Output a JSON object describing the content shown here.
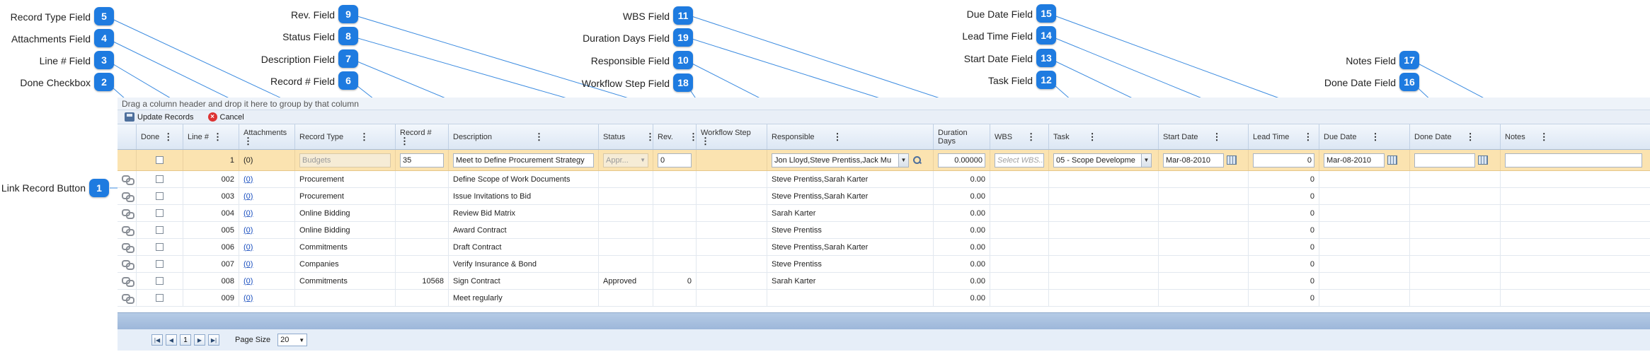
{
  "grid": {
    "group_hint": "Drag a column header and drop it here to group by that column",
    "toolbar": {
      "update_label": "Update Records",
      "cancel_label": "Cancel"
    },
    "columns": [
      "Done",
      "Line #",
      "Attachments",
      "Record Type",
      "Record #",
      "Description",
      "Status",
      "Rev.",
      "Workflow Step",
      "Responsible",
      "Duration Days",
      "WBS",
      "Task",
      "Start Date",
      "Lead Time",
      "Due Date",
      "Done Date",
      "Notes"
    ],
    "edit_row": {
      "line": "1",
      "attachments": "(0)",
      "record_type": "Budgets",
      "record_no": "35",
      "description": "Meet to Define Procurement Strategy",
      "status": "Appr...",
      "rev": "0",
      "responsible": "Jon Lloyd,Steve Prentiss,Jack Mu",
      "duration": "0.00000",
      "wbs_placeholder": "Select WBS...",
      "task": "05 - Scope Developme",
      "start_date": "Mar-08-2010",
      "lead_time": "0",
      "due_date": "Mar-08-2010"
    },
    "rows": [
      {
        "line": "002",
        "att": "(0)",
        "type": "Procurement",
        "rec": "",
        "desc": "Define Scope of Work Documents",
        "status": "",
        "rev": "",
        "resp": "Steve Prentiss,Sarah Karter",
        "dur": "0.00",
        "lead": "0"
      },
      {
        "line": "003",
        "att": "(0)",
        "type": "Procurement",
        "rec": "",
        "desc": "Issue Invitations to Bid",
        "status": "",
        "rev": "",
        "resp": "Steve Prentiss,Sarah Karter",
        "dur": "0.00",
        "lead": "0"
      },
      {
        "line": "004",
        "att": "(0)",
        "type": "Online Bidding",
        "rec": "",
        "desc": "Review Bid Matrix",
        "status": "",
        "rev": "",
        "resp": "Sarah Karter",
        "dur": "0.00",
        "lead": "0"
      },
      {
        "line": "005",
        "att": "(0)",
        "type": "Online Bidding",
        "rec": "",
        "desc": "Award Contract",
        "status": "",
        "rev": "",
        "resp": "Steve Prentiss",
        "dur": "0.00",
        "lead": "0"
      },
      {
        "line": "006",
        "att": "(0)",
        "type": "Commitments",
        "rec": "",
        "desc": "Draft Contract",
        "status": "",
        "rev": "",
        "resp": "Steve Prentiss,Sarah Karter",
        "dur": "0.00",
        "lead": "0"
      },
      {
        "line": "007",
        "att": "(0)",
        "type": "Companies",
        "rec": "",
        "desc": "Verify Insurance & Bond",
        "status": "",
        "rev": "",
        "resp": "Steve Prentiss",
        "dur": "0.00",
        "lead": "0"
      },
      {
        "line": "008",
        "att": "(0)",
        "type": "Commitments",
        "rec": "10568",
        "desc": "Sign Contract",
        "status": "Approved",
        "rev": "0",
        "resp": "Sarah Karter",
        "dur": "0.00",
        "lead": "0"
      },
      {
        "line": "009",
        "att": "(0)",
        "type": "",
        "rec": "",
        "desc": "Meet regularly",
        "status": "",
        "rev": "",
        "resp": "",
        "dur": "0.00",
        "lead": "0"
      }
    ],
    "pager": {
      "current_page": "1",
      "page_size_label": "Page Size",
      "page_size": "20"
    }
  },
  "callouts": [
    {
      "num": "5",
      "label": "Record Type Field"
    },
    {
      "num": "4",
      "label": "Attachments Field"
    },
    {
      "num": "3",
      "label": "Line # Field"
    },
    {
      "num": "2",
      "label": "Done Checkbox"
    },
    {
      "num": "9",
      "label": "Rev. Field"
    },
    {
      "num": "8",
      "label": "Status Field"
    },
    {
      "num": "7",
      "label": "Description Field"
    },
    {
      "num": "6",
      "label": "Record # Field"
    },
    {
      "num": "11",
      "label": "WBS Field"
    },
    {
      "num": "19",
      "label": "Duration Days Field"
    },
    {
      "num": "10",
      "label": "Responsible Field"
    },
    {
      "num": "18",
      "label": "Workflow Step Field"
    },
    {
      "num": "15",
      "label": "Due Date Field"
    },
    {
      "num": "14",
      "label": "Lead Time Field"
    },
    {
      "num": "13",
      "label": "Start Date Field"
    },
    {
      "num": "12",
      "label": "Task Field"
    },
    {
      "num": "17",
      "label": "Notes Field"
    },
    {
      "num": "16",
      "label": "Done Date Field"
    },
    {
      "num": "1",
      "label": "Link Record Button"
    }
  ]
}
